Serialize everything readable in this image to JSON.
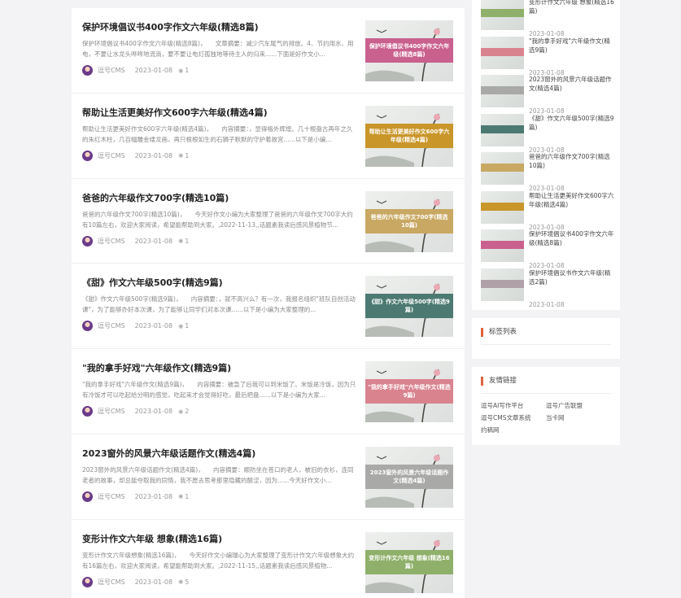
{
  "articles": [
    {
      "title": "保护环境倡议书400字作文六年级(精选8篇)",
      "excerpt": "保护环境倡议书400字作文六年级(精选8篇)，　　文章摘要：减少汽车尾气的排放。4、节约用水、用电，不要让水龙头哗哗地流淌，要不要让电灯孤独地等待主人的归来......下面是好作文小...",
      "author": "逗号CMS",
      "date": "2023-01-08",
      "views": "1",
      "thumb_text": "保护环境倡议书400字作文六年级(精选8篇)",
      "band_color": "#c9608e"
    },
    {
      "title": "帮助让生活更美好作文600字六年级(精选4篇)",
      "excerpt": "帮助让生活更美好作文600字六年级(精选4篇)，　　内容摘要：，显得格外辉煌。几十根盘古再年之久的朱红木柱，几百幅雕金缕龙画，再只根根如生的石狮子默默的守护着故宫......以下是小编...",
      "author": "逗号CMS",
      "date": "2023-01-08",
      "views": "1",
      "thumb_text": "帮助让生活更美好作文600字六年级(精选4篇)",
      "band_color": "#c9962a"
    },
    {
      "title": "爸爸的六年级作文700字(精选10篇)",
      "excerpt": "爸爸的六年级作文700字(精选10篇)，　　今天好作文小编为大家整理了爸爸的六年级作文700字大约有10篇左右，欢迎大家阅读，希望能帮助到大家。,2022-11-13,,话题素我读后感风景植物节...",
      "author": "逗号CMS",
      "date": "2023-01-08",
      "views": "1",
      "thumb_text": "爸爸的六年级作文700字(精选10篇)",
      "band_color": "#c8a862"
    },
    {
      "title": "《甜》作文六年级500字(精选9篇)",
      "excerpt": "《甜》作文六年级500字(精选9篇)，　　内容摘要：，就不高兴么？有一次，我报名组织\"班队自创活动课\"，为了能够办好本次课，为了能够让同学们对本次课......以下是小编为大家整理的...",
      "author": "逗号CMS",
      "date": "2023-01-08",
      "views": "1",
      "thumb_text": "《甜》作文六年级500字(精选9篇)",
      "band_color": "#4c7a72"
    },
    {
      "title": "\"我的拿手好戏\"六年级作文(精选9篇)",
      "excerpt": "\"我的拿手好戏\"六年级作文(精选9篇)，　　内容摘要：被急了后我可以到米饭了。米饭是冷饭，因为只有冷饭才可以吃起给分明的感觉，吃起来才会觉得好吃，最后把盘......以下是小编为大家...",
      "author": "逗号CMS",
      "date": "2023-01-08",
      "views": "2",
      "thumb_text": "\"我的拿手好戏\"六年级作文(精选9篇)",
      "band_color": "#d9838f"
    },
    {
      "title": "2023窗外的风景六年级话题作文(精选4篇)",
      "excerpt": "2023窗外的风景六年级话题作文(精选4篇)，　　内容摘要：顺防坐在苍口的老人，被旧的衣衫，连同老者的故事，却总能夺取我的同情，我不愿去思考那里隐藏的酸涩，因为......今天好作文小...",
      "author": "逗号CMS",
      "date": "2023-01-08",
      "views": "1",
      "thumb_text": "2023窗外的风景六年级话题作文(精选4篇)",
      "band_color": "#a9aaa8"
    },
    {
      "title": "变形计作文六年级 想象(精选16篇)",
      "excerpt": "变形计作文六年级想象(精选16篇)，　　今天好作文小编瑞心为大家整理了变形计作文六年级想象大约有16篇左右，欢迎大家阅读，希望能帮助到大家。,2022-11-15,,话题素我读后感风景植物...",
      "author": "逗号CMS",
      "date": "2023-01-08",
      "views": "5",
      "thumb_text": "变形计作文六年级 想象(精选16篇)",
      "band_color": "#8fb06a"
    }
  ],
  "sidebar_posts": [
    {
      "title": "变形计作文六年级 想象(精选16篇)",
      "date": "2023-01-08",
      "band_color": "#8fb06a"
    },
    {
      "title": "\"我的拿手好戏\"六年级作文(精选9篇)",
      "date": "2023-01-08",
      "band_color": "#d9838f"
    },
    {
      "title": "2023窗外的风景六年级话题作文(精选4篇)",
      "date": "2023-01-08",
      "band_color": "#a9aaa8"
    },
    {
      "title": "《甜》作文六年级500字(精选9篇)",
      "date": "2023-01-08",
      "band_color": "#4c7a72"
    },
    {
      "title": "爸爸的六年级作文700字(精选10篇)",
      "date": "2023-01-08",
      "band_color": "#c8a862"
    },
    {
      "title": "帮助让生活更美好作文600字六年级(精选4篇)",
      "date": "2023-01-08",
      "band_color": "#c9962a"
    },
    {
      "title": "保护环境倡议书400字作文六年级(精选8篇)",
      "date": "2023-01-08",
      "band_color": "#c9608e"
    },
    {
      "title": "保护环境倡议书作文六年级(精选2篇)",
      "date": "2023-01-08",
      "band_color": "#b0a0a8"
    }
  ],
  "tags_widget": {
    "title": "标签列表"
  },
  "links_widget": {
    "title": "友情链接",
    "links": [
      "逗号AI写作平台",
      "逗号广告联盟",
      "逗号CMS文章系统",
      "当卡网",
      "约稿网"
    ]
  }
}
